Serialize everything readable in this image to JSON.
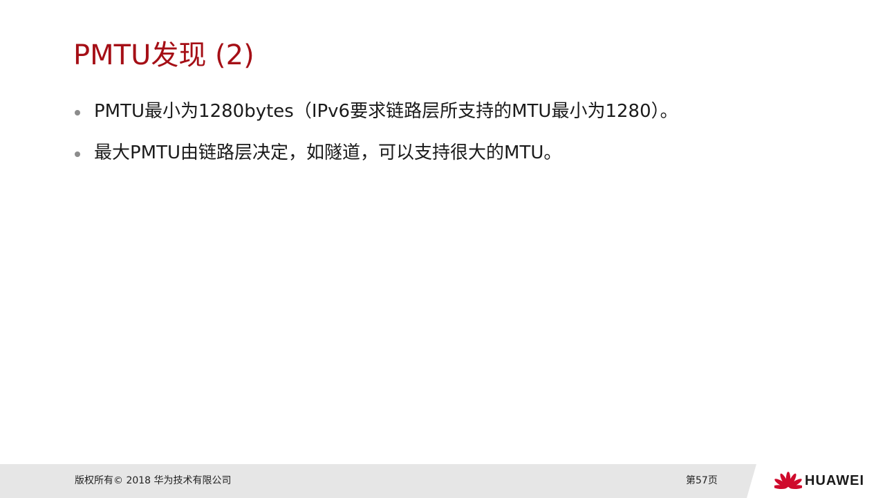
{
  "slide": {
    "title": "PMTU发现 (2)",
    "bullets": [
      {
        "text": "PMTU最小为1280bytes（IPv6要求链路层所支持的MTU最小为1280）。"
      },
      {
        "text": "最大PMTU由链路层决定，如隧道，可以支持很大的MTU。"
      }
    ]
  },
  "footer": {
    "copyright": "版权所有© 2018 华为技术有限公司",
    "page_number": "第57页",
    "brand_name": "HUAWEI",
    "logo_icon": "huawei-petal-logo"
  },
  "colors": {
    "title": "#a50f16",
    "text": "#1a1a1a",
    "bullet": "#8c8c8c",
    "footer_bg": "#e6e6e6",
    "logo_red": "#cf0a2c"
  }
}
